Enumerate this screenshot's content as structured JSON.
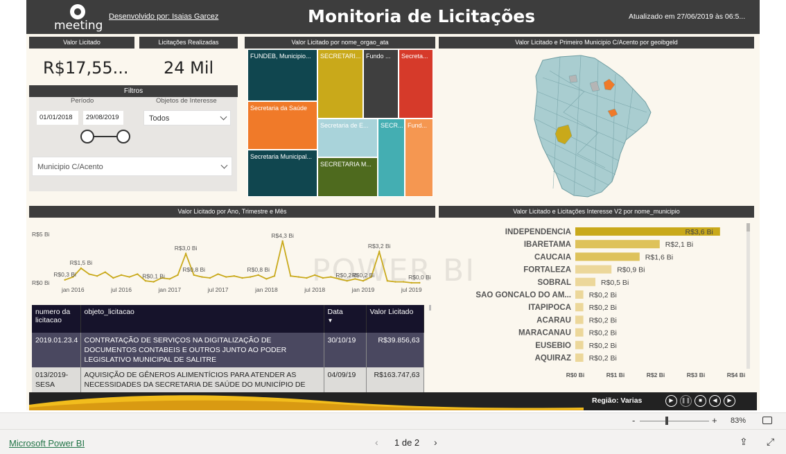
{
  "header": {
    "logo_text": "meeting",
    "developer": "Desenvolvido por: Isaias Garcez",
    "title": "Monitoria de Licitações",
    "updated": "Atualizado em 27/06/2019 às 06:5..."
  },
  "cards": {
    "valor_header": "Valor Licitado",
    "valor": "R$17,55...",
    "licitacoes_header": "Licitações Realizadas",
    "licitacoes": "24 Mil"
  },
  "filters": {
    "header": "Filtros",
    "periodo_label": "Período",
    "start_date": "01/01/2018",
    "end_date": "29/08/2019",
    "objetos_label": "Objetos de Interesse",
    "objetos_value": "Todos",
    "municipio_placeholder": "Municipio C/Acento"
  },
  "treemap": {
    "header": "Valor Licitado por nome_orgao_ata",
    "tiles": [
      {
        "label": "FUNDEB, Municipio...",
        "color": "#10464f"
      },
      {
        "label": "SECRETARI...",
        "color": "#c9a91a"
      },
      {
        "label": "Fundo ...",
        "color": "#3f3f3f"
      },
      {
        "label": "Secreta...",
        "color": "#d63a2a"
      },
      {
        "label": "Secretaria da Saúde",
        "color": "#f07a29"
      },
      {
        "label": "Secretaria de E...",
        "color": "#a9d3da"
      },
      {
        "label": "SECR...",
        "color": "#44aeb2"
      },
      {
        "label": "Fund...",
        "color": "#f59751"
      },
      {
        "label": "Secretaria Municipal...",
        "color": "#10464f"
      },
      {
        "label": "SECRETARIA M...",
        "color": "#4e6a1e"
      }
    ]
  },
  "map": {
    "header": "Valor Licitado e Primeiro Municipio C/Acento por geoibgeld"
  },
  "line_chart": {
    "header": "Valor Licitado por Ano, Trimestre e Mês"
  },
  "bar_chart": {
    "header": "Valor Licitado e Licitações Interesse V2 por nome_municipio"
  },
  "chart_data": [
    {
      "type": "line",
      "title": "Valor Licitado por Ano, Trimestre e Mês",
      "color": "#c9a91a",
      "yticks": [
        "R$5 Bi",
        "R$0 Bi"
      ],
      "ylim": [
        0,
        5
      ],
      "xticks": [
        "jan 2016",
        "jul 2016",
        "jan 2017",
        "jul 2017",
        "jan 2018",
        "jul 2018",
        "jan 2019",
        "jul 2019"
      ],
      "x_range": [
        "2015-11",
        "2019-09"
      ],
      "y_unit": "R$ Bi",
      "points": [
        {
          "x": "2015-12",
          "y": 0.3
        },
        {
          "x": "2016-01",
          "y": 0.6
        },
        {
          "x": "2016-02",
          "y": 1.5
        },
        {
          "x": "2016-03",
          "y": 0.9
        },
        {
          "x": "2016-04",
          "y": 0.7
        },
        {
          "x": "2016-05",
          "y": 1.1
        },
        {
          "x": "2016-06",
          "y": 0.5
        },
        {
          "x": "2016-07",
          "y": 0.8
        },
        {
          "x": "2016-08",
          "y": 0.6
        },
        {
          "x": "2016-09",
          "y": 0.9
        },
        {
          "x": "2016-10",
          "y": 0.2
        },
        {
          "x": "2016-11",
          "y": 0.1
        },
        {
          "x": "2016-12",
          "y": 0.5
        },
        {
          "x": "2017-01",
          "y": 0.4
        },
        {
          "x": "2017-02",
          "y": 0.8
        },
        {
          "x": "2017-03",
          "y": 3.0
        },
        {
          "x": "2017-04",
          "y": 0.8
        },
        {
          "x": "2017-05",
          "y": 0.6
        },
        {
          "x": "2017-06",
          "y": 0.5
        },
        {
          "x": "2017-07",
          "y": 0.9
        },
        {
          "x": "2017-08",
          "y": 0.6
        },
        {
          "x": "2017-09",
          "y": 0.7
        },
        {
          "x": "2017-10",
          "y": 0.5
        },
        {
          "x": "2017-11",
          "y": 0.6
        },
        {
          "x": "2017-12",
          "y": 0.8
        },
        {
          "x": "2018-01",
          "y": 0.4
        },
        {
          "x": "2018-02",
          "y": 0.7
        },
        {
          "x": "2018-03",
          "y": 4.3
        },
        {
          "x": "2018-04",
          "y": 0.7
        },
        {
          "x": "2018-05",
          "y": 0.6
        },
        {
          "x": "2018-06",
          "y": 0.5
        },
        {
          "x": "2018-07",
          "y": 0.8
        },
        {
          "x": "2018-08",
          "y": 0.5
        },
        {
          "x": "2018-09",
          "y": 0.6
        },
        {
          "x": "2018-10",
          "y": 0.4
        },
        {
          "x": "2018-11",
          "y": 0.2
        },
        {
          "x": "2018-12",
          "y": 0.4
        },
        {
          "x": "2019-01",
          "y": 0.2
        },
        {
          "x": "2019-02",
          "y": 0.6
        },
        {
          "x": "2019-03",
          "y": 3.2
        },
        {
          "x": "2019-04",
          "y": 0.2
        },
        {
          "x": "2019-05",
          "y": 0.1
        },
        {
          "x": "2019-06",
          "y": 0.1
        },
        {
          "x": "2019-07",
          "y": 0.0
        },
        {
          "x": "2019-08",
          "y": 0.0
        }
      ],
      "labels": [
        {
          "x": "2015-12",
          "y": 0.3,
          "text": "R$0,3 Bi"
        },
        {
          "x": "2016-02",
          "y": 1.5,
          "text": "R$1,5 Bi"
        },
        {
          "x": "2016-11",
          "y": 0.1,
          "text": "R$0,1 Bi"
        },
        {
          "x": "2017-03",
          "y": 3.0,
          "text": "R$3,0 Bi"
        },
        {
          "x": "2017-04",
          "y": 0.8,
          "text": "R$0,8 Bi"
        },
        {
          "x": "2017-12",
          "y": 0.8,
          "text": "R$0,8 Bi"
        },
        {
          "x": "2018-03",
          "y": 4.3,
          "text": "R$4,3 Bi"
        },
        {
          "x": "2018-11",
          "y": 0.2,
          "text": "R$0,2 Bi"
        },
        {
          "x": "2019-01",
          "y": 0.2,
          "text": "R$0,2 Bi"
        },
        {
          "x": "2019-03",
          "y": 3.2,
          "text": "R$3,2 Bi"
        },
        {
          "x": "2019-08",
          "y": 0.0,
          "text": "R$0,0 Bi"
        }
      ]
    },
    {
      "type": "bar",
      "orientation": "horizontal",
      "title": "Valor Licitado e Licitações Interesse V2 por nome_municipio",
      "categories": [
        "INDEPENDENCIA",
        "IBARETAMA",
        "CAUCAIA",
        "FORTALEZA",
        "SOBRAL",
        "SAO GONCALO DO AM...",
        "ITAPIPOCA",
        "ACARAU",
        "MARACANAU",
        "EUSEBIO",
        "AQUIRAZ"
      ],
      "values": [
        3.6,
        2.1,
        1.6,
        0.9,
        0.5,
        0.2,
        0.2,
        0.2,
        0.2,
        0.2,
        0.2
      ],
      "value_labels": [
        "R$3,6 Bi",
        "R$2,1 Bi",
        "R$1,6 Bi",
        "R$0,9 Bi",
        "R$0,5 Bi",
        "R$0,2 Bi",
        "R$0,2 Bi",
        "R$0,2 Bi",
        "R$0,2 Bi",
        "R$0,2 Bi",
        "R$0,2 Bi"
      ],
      "colors": [
        "#c9a91a",
        "#dec25a",
        "#dec25a",
        "#ecd79a",
        "#ecd79a",
        "#ecd79a",
        "#ecd79a",
        "#ecd79a",
        "#ecd79a",
        "#ecd79a",
        "#ecd79a"
      ],
      "xticks": [
        "R$0 Bi",
        "R$1 Bi",
        "R$2 Bi",
        "R$3 Bi",
        "R$4 Bi"
      ],
      "xlim": [
        0,
        4
      ],
      "unit": "R$ Bi"
    }
  ],
  "table": {
    "columns": [
      "numero da licitacao",
      "objeto_licitacao",
      "Data",
      "Valor Licitado"
    ],
    "rows": [
      [
        "2019.01.23.4",
        "CONTRATAÇÃO DE SERVIÇOS NA DIGITALIZAÇÃO DE DOCUMENTOS CONTABEIS E OUTROS JUNTO AO PODER LEGISLATIVO MUNICIPAL DE SALITRE",
        "30/10/19",
        "R$39.856,63"
      ],
      [
        "013/2019-SESA",
        "AQUISIÇÃO DE GÊNEROS ALIMENTÍCIOS PARA ATENDER AS NECESSIDADES DA SECRETARIA DE SAÚDE DO MUNICÍPIO DE",
        "04/09/19",
        "R$163.747,63"
      ]
    ]
  },
  "footer": {
    "regiao": "Região: Varias"
  },
  "watermark": "POWER BI",
  "status": {
    "zoom_minus": "-",
    "zoom_plus": "+",
    "zoom": "83%",
    "brand": "Microsoft Power BI",
    "page": "1 de 2"
  }
}
